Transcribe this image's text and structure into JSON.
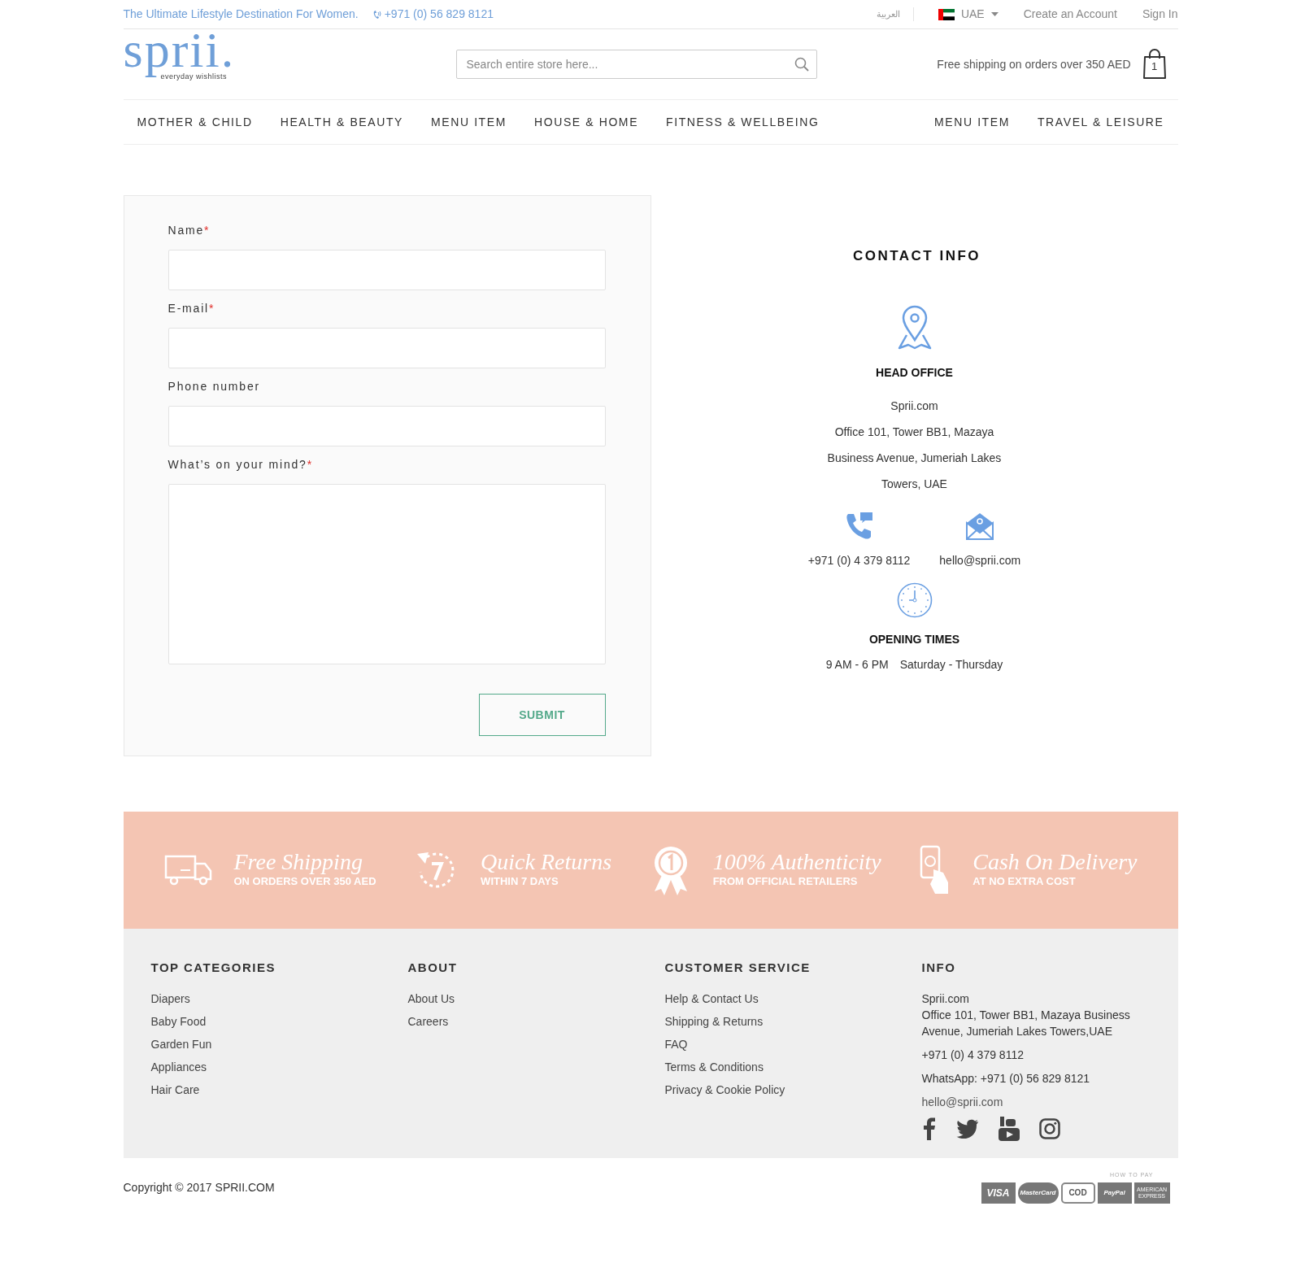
{
  "top_bar": {
    "tagline": "The Ultimate Lifestyle Destination For Women.",
    "phone": "+971 (0) 56 829 8121",
    "language": "العربية",
    "country": "UAE",
    "links": [
      "Create an Account",
      "Sign In"
    ]
  },
  "header": {
    "logo": "sprii.",
    "logo_tagline": "everyday wishlists",
    "search": {
      "placeholder": "Search entire store here..."
    },
    "shipping_note": "Free shipping on orders over 350 AED",
    "cart_count": "1"
  },
  "nav": {
    "left": [
      "MOTHER & CHILD",
      "HEALTH & BEAUTY",
      "MENU ITEM",
      "HOUSE & HOME",
      "FITNESS & WELLBEING"
    ],
    "right": [
      "MENU ITEM",
      "TRAVEL & LEISURE"
    ]
  },
  "form": {
    "fields": [
      {
        "kind": "input",
        "label": "Name",
        "required_mark": "*"
      },
      {
        "kind": "input",
        "label": "E-mail",
        "required_mark": "*"
      },
      {
        "kind": "input",
        "label": "Phone number"
      },
      {
        "kind": "textarea",
        "label": "What’s on your mind?",
        "required_mark": "*"
      }
    ],
    "submit": "SUBMIT"
  },
  "contact": {
    "title": "CONTACT INFO",
    "office_title": "HEAD OFFICE",
    "address_lines": [
      "Sprii.com",
      "Office 101, Tower BB1, Mazaya",
      "Business Avenue, Jumeriah Lakes",
      "Towers, UAE"
    ],
    "phone": "+971 (0) 4 379 8112",
    "email": "hello@sprii.com",
    "hours_title": "OPENING TIMES",
    "hours": "9 AM - 6 PM",
    "days": "Saturday - Thursday"
  },
  "features": [
    {
      "kind": "truck",
      "title": "Free Shipping",
      "subtitle": "ON ORDERS OVER 350 AED"
    },
    {
      "kind": "returns",
      "title": "Quick Returns",
      "subtitle": "WITHIN 7 DAYS"
    },
    {
      "kind": "ribbon",
      "title": "100% Authenticity",
      "subtitle": "FROM OFFICIAL RETAILERS"
    },
    {
      "kind": "cash",
      "title": "Cash On Delivery",
      "subtitle": "AT NO EXTRA COST"
    }
  ],
  "footer": {
    "columns": [
      {
        "heading": "TOP CATEGORIES",
        "links": [
          "Diapers",
          "Baby Food",
          "Garden Fun",
          "Appliances",
          "Hair Care"
        ]
      },
      {
        "heading": "ABOUT",
        "links": [
          "About Us",
          "Careers"
        ]
      },
      {
        "heading": "CUSTOMER SERVICE",
        "links": [
          "Help & Contact Us",
          "Shipping & Returns",
          "FAQ",
          "Terms & Conditions",
          "Privacy & Cookie Policy"
        ]
      }
    ],
    "info": {
      "heading": "INFO",
      "company": "Sprii.com",
      "address": "Office 101, Tower BB1, Mazaya Business Avenue, Jumeriah Lakes Towers,UAE",
      "phone": "+971 (0) 4 379 8112",
      "whatsapp": "WhatsApp: +971 (0) 56 829 8121",
      "email": "hello@sprii.com"
    },
    "social": [
      {
        "kind": "facebook"
      },
      {
        "kind": "twitter"
      },
      {
        "kind": "youtube"
      },
      {
        "kind": "instagram"
      }
    ]
  },
  "bottom": {
    "copyright": "Copyright © 2017 SPRII.COM",
    "pay_label": "HOW TO PAY",
    "payments": [
      "VISA",
      "MasterCard",
      "COD",
      "PayPal",
      "AMERICAN EXPRESS"
    ]
  }
}
